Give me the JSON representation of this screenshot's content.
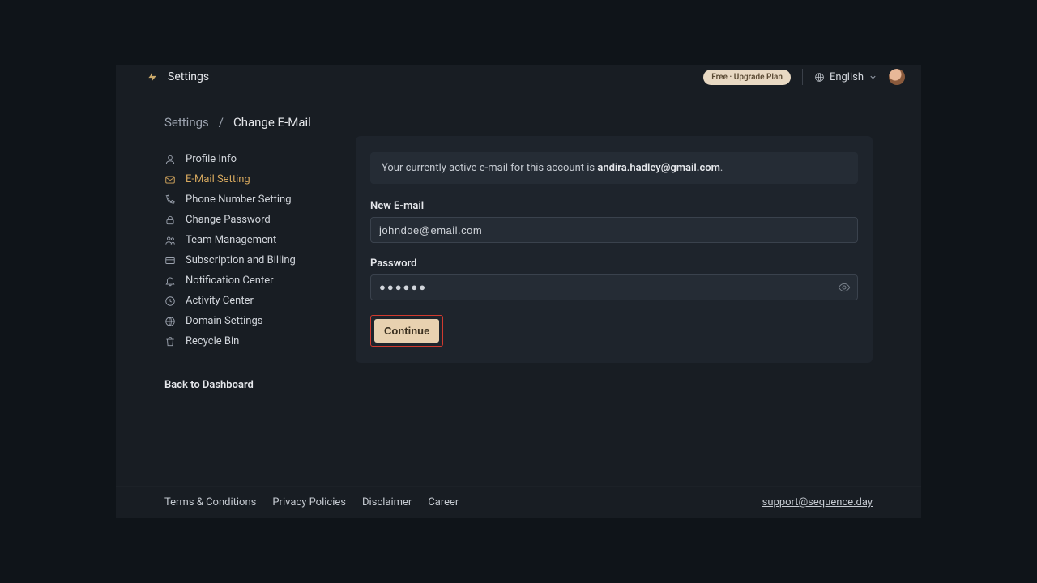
{
  "header": {
    "title": "Settings",
    "plan_pill": "Free · Upgrade Plan",
    "language": "English"
  },
  "breadcrumb": {
    "root": "Settings",
    "sep": "/",
    "current": "Change E-Mail"
  },
  "sidebar": {
    "items": [
      {
        "label": "Profile Info"
      },
      {
        "label": "E-Mail Setting"
      },
      {
        "label": "Phone Number Setting"
      },
      {
        "label": "Change Password"
      },
      {
        "label": "Team Management"
      },
      {
        "label": "Subscription and Billing"
      },
      {
        "label": "Notification Center"
      },
      {
        "label": "Activity Center"
      },
      {
        "label": "Domain Settings"
      },
      {
        "label": "Recycle Bin"
      }
    ],
    "back": "Back to Dashboard"
  },
  "main": {
    "banner_prefix": "Your currently active e-mail for this account is ",
    "banner_email": "andira.hadley@gmail.com",
    "banner_suffix": ".",
    "new_email_label": "New E-mail",
    "new_email_value": "johndoe@email.com",
    "password_label": "Password",
    "password_masked": "●●●●●●",
    "continue": "Continue"
  },
  "footer": {
    "links": [
      "Terms & Conditions",
      "Privacy Policies",
      "Disclaimer",
      "Career"
    ],
    "support": "support@sequence.day"
  }
}
